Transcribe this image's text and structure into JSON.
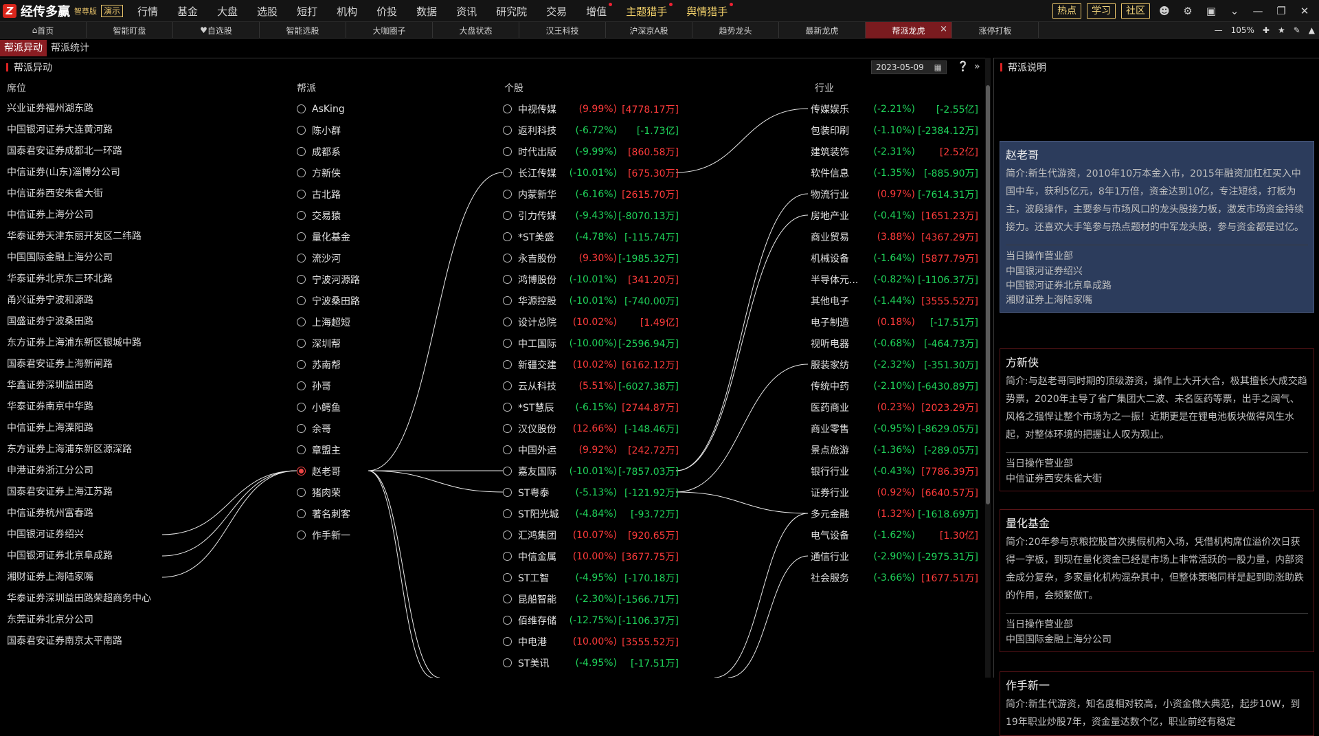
{
  "app": {
    "logo_text": "经传多赢",
    "edition": "智尊版",
    "demo": "演示",
    "menu": [
      "行情",
      "基金",
      "大盘",
      "选股",
      "短打",
      "机构",
      "价投",
      "数据",
      "资讯",
      "研究院",
      "交易",
      "增值",
      "主题猎手",
      "舆情猎手"
    ],
    "right_buttons": [
      "热点",
      "学习",
      "社区"
    ]
  },
  "tabs": [
    "首页",
    "智能盯盘",
    "自选股",
    "智能选股",
    "大咖圈子",
    "大盘状态",
    "汉王科技",
    "沪深京A股",
    "趋势龙头",
    "最新龙虎",
    "帮派龙虎",
    "涨停打板"
  ],
  "zoom": {
    "level": "105%"
  },
  "subtabs": [
    "帮派异动",
    "帮派统计"
  ],
  "main": {
    "title": "帮派异动",
    "date": "2023-05-09",
    "columns": {
      "seat": "席位",
      "gang": "帮派",
      "stock": "个股",
      "industry": "行业"
    }
  },
  "seats": [
    "兴业证券福州湖东路",
    "中国银河证券大连黄河路",
    "国泰君安证券成都北一环路",
    "中信证券(山东)淄博分公司",
    "中信证券西安朱雀大街",
    "中信证券上海分公司",
    "华泰证券天津东丽开发区二纬路",
    "中国国际金融上海分公司",
    "华泰证券北京东三环北路",
    "甬兴证券宁波和源路",
    "国盛证券宁波桑田路",
    "东方证券上海浦东新区银城中路",
    "国泰君安证券上海新闸路",
    "华鑫证券深圳益田路",
    "华泰证券南京中华路",
    "中信证券上海溧阳路",
    "东方证券上海浦东新区源深路",
    "申港证券浙江分公司",
    "国泰君安证券上海江苏路",
    "中信证券杭州富春路",
    "中国银河证券绍兴",
    "中国银河证券北京阜成路",
    "湘财证券上海陆家嘴",
    "华泰证券深圳益田路荣超商务中心",
    "东莞证券北京分公司",
    "国泰君安证券南京太平南路"
  ],
  "gangs": [
    "AsKing",
    "陈小群",
    "成都系",
    "方新侠",
    "古北路",
    "交易猿",
    "量化基金",
    "流沙河",
    "宁波河源路",
    "宁波桑田路",
    "上海超短",
    "深圳帮",
    "苏南帮",
    "孙哥",
    "小鳄鱼",
    "余哥",
    "章盟主",
    "赵老哥",
    "猪肉荣",
    "著名刺客",
    "作手新一"
  ],
  "selected_gang": "赵老哥",
  "stocks": [
    {
      "name": "中视传媒",
      "pct": "(9.99%)",
      "amt": "[4778.17万]",
      "dir": "up"
    },
    {
      "name": "返利科技",
      "pct": "(-6.72%)",
      "amt": "[-1.73亿]",
      "dir": "down"
    },
    {
      "name": "时代出版",
      "pct": "(-9.99%)",
      "amt": "[860.58万]",
      "dir": "down",
      "amt_dir": "up"
    },
    {
      "name": "长江传媒",
      "pct": "(-10.01%)",
      "amt": "[675.30万]",
      "dir": "down",
      "amt_dir": "up"
    },
    {
      "name": "内蒙新华",
      "pct": "(-6.16%)",
      "amt": "[2615.70万]",
      "dir": "down",
      "amt_dir": "up"
    },
    {
      "name": "引力传媒",
      "pct": "(-9.43%)",
      "amt": "[-8070.13万]",
      "dir": "down"
    },
    {
      "name": "*ST美盛",
      "pct": "(-4.78%)",
      "amt": "[-115.74万]",
      "dir": "down"
    },
    {
      "name": "永吉股份",
      "pct": "(9.30%)",
      "amt": "[-1985.32万]",
      "dir": "up",
      "amt_dir": "down"
    },
    {
      "name": "鸿博股份",
      "pct": "(-10.01%)",
      "amt": "[341.20万]",
      "dir": "down",
      "amt_dir": "up"
    },
    {
      "name": "华源控股",
      "pct": "(-10.01%)",
      "amt": "[-740.00万]",
      "dir": "down"
    },
    {
      "name": "设计总院",
      "pct": "(10.02%)",
      "amt": "[1.49亿]",
      "dir": "up"
    },
    {
      "name": "中工国际",
      "pct": "(-10.00%)",
      "amt": "[-2596.94万]",
      "dir": "down"
    },
    {
      "name": "新疆交建",
      "pct": "(10.02%)",
      "amt": "[6162.12万]",
      "dir": "up"
    },
    {
      "name": "云从科技",
      "pct": "(5.51%)",
      "amt": "[-6027.38万]",
      "dir": "up",
      "amt_dir": "down"
    },
    {
      "name": "*ST慧辰",
      "pct": "(-6.15%)",
      "amt": "[2744.87万]",
      "dir": "down",
      "amt_dir": "up"
    },
    {
      "name": "汉仪股份",
      "pct": "(12.66%)",
      "amt": "[-148.46万]",
      "dir": "up",
      "amt_dir": "down"
    },
    {
      "name": "中国外运",
      "pct": "(9.92%)",
      "amt": "[242.72万]",
      "dir": "up"
    },
    {
      "name": "嘉友国际",
      "pct": "(-10.01%)",
      "amt": "[-7857.03万]",
      "dir": "down"
    },
    {
      "name": "ST粤泰",
      "pct": "(-5.13%)",
      "amt": "[-121.92万]",
      "dir": "down"
    },
    {
      "name": "ST阳光城",
      "pct": "(-4.84%)",
      "amt": "[-93.72万]",
      "dir": "down"
    },
    {
      "name": "汇鸿集团",
      "pct": "(10.07%)",
      "amt": "[920.65万]",
      "dir": "up"
    },
    {
      "name": "中信金属",
      "pct": "(10.00%)",
      "amt": "[3677.75万]",
      "dir": "up"
    },
    {
      "name": "ST工智",
      "pct": "(-4.95%)",
      "amt": "[-170.18万]",
      "dir": "down"
    },
    {
      "name": "昆船智能",
      "pct": "(-2.30%)",
      "amt": "[-1566.71万]",
      "dir": "down"
    },
    {
      "name": "佰维存储",
      "pct": "(-12.75%)",
      "amt": "[-1106.37万]",
      "dir": "down"
    },
    {
      "name": "中电港",
      "pct": "(10.00%)",
      "amt": "[3555.52万]",
      "dir": "up"
    },
    {
      "name": "ST美讯",
      "pct": "(-4.95%)",
      "amt": "[-17.51万]",
      "dir": "down"
    }
  ],
  "industries": [
    {
      "name": "传媒娱乐",
      "pct": "(-2.21%)",
      "amt": "[-2.55亿]",
      "dir": "down"
    },
    {
      "name": "包装印刷",
      "pct": "(-1.10%)",
      "amt": "[-2384.12万]",
      "dir": "down"
    },
    {
      "name": "建筑装饰",
      "pct": "(-2.31%)",
      "amt": "[2.52亿]",
      "dir": "down",
      "amt_dir": "up"
    },
    {
      "name": "软件信息",
      "pct": "(-1.35%)",
      "amt": "[-885.90万]",
      "dir": "down"
    },
    {
      "name": "物流行业",
      "pct": "(0.97%)",
      "amt": "[-7614.31万]",
      "dir": "up",
      "amt_dir": "down"
    },
    {
      "name": "房地产业",
      "pct": "(-0.41%)",
      "amt": "[1651.23万]",
      "dir": "down",
      "amt_dir": "up"
    },
    {
      "name": "商业贸易",
      "pct": "(3.88%)",
      "amt": "[4367.29万]",
      "dir": "up"
    },
    {
      "name": "机械设备",
      "pct": "(-1.64%)",
      "amt": "[5877.79万]",
      "dir": "down",
      "amt_dir": "up"
    },
    {
      "name": "半导体元...",
      "pct": "(-0.82%)",
      "amt": "[-1106.37万]",
      "dir": "down"
    },
    {
      "name": "其他电子",
      "pct": "(-1.44%)",
      "amt": "[3555.52万]",
      "dir": "down",
      "amt_dir": "up"
    },
    {
      "name": "电子制造",
      "pct": "(0.18%)",
      "amt": "[-17.51万]",
      "dir": "up",
      "amt_dir": "down"
    },
    {
      "name": "视听电器",
      "pct": "(-0.68%)",
      "amt": "[-464.73万]",
      "dir": "down"
    },
    {
      "name": "服装家纺",
      "pct": "(-2.32%)",
      "amt": "[-351.30万]",
      "dir": "down"
    },
    {
      "name": "传统中药",
      "pct": "(-2.10%)",
      "amt": "[-6430.89万]",
      "dir": "down"
    },
    {
      "name": "医药商业",
      "pct": "(0.23%)",
      "amt": "[2023.29万]",
      "dir": "up"
    },
    {
      "name": "商业零售",
      "pct": "(-0.95%)",
      "amt": "[-8629.05万]",
      "dir": "down"
    },
    {
      "name": "景点旅游",
      "pct": "(-1.36%)",
      "amt": "[-289.05万]",
      "dir": "down"
    },
    {
      "name": "银行行业",
      "pct": "(-0.43%)",
      "amt": "[7786.39万]",
      "dir": "down",
      "amt_dir": "up"
    },
    {
      "name": "证券行业",
      "pct": "(0.92%)",
      "amt": "[6640.57万]",
      "dir": "up"
    },
    {
      "name": "多元金融",
      "pct": "(1.32%)",
      "amt": "[-1618.69万]",
      "dir": "up",
      "amt_dir": "down"
    },
    {
      "name": "电气设备",
      "pct": "(-1.62%)",
      "amt": "[1.30亿]",
      "dir": "down",
      "amt_dir": "up"
    },
    {
      "name": "通信行业",
      "pct": "(-2.90%)",
      "amt": "[-2975.31万]",
      "dir": "down"
    },
    {
      "name": "社会服务",
      "pct": "(-3.66%)",
      "amt": "[1677.51万]",
      "dir": "down",
      "amt_dir": "up"
    }
  ],
  "right": {
    "title": "帮派说明",
    "cards": [
      {
        "name": "赵老哥",
        "desc": "简介:新生代游资，2010年10万本金入市，2015年融资加杠杠买入中国中车，获利5亿元，8年1万倍，资金达到10亿，专注短线，打板为主，波段操作，主要参与市场风口的龙头股接力板，激发市场资金持续接力。还喜欢大手笔参与热点题材的中军龙头股，参与资金都是过亿。",
        "sub": "当日操作营业部",
        "depts": [
          "中国银河证券绍兴",
          "中国银河证券北京阜成路",
          "湘财证券上海陆家嘴"
        ]
      },
      {
        "name": "方新侠",
        "desc": "简介:与赵老哥同时期的顶级游资，操作上大开大合，极其擅长大成交趋势票，2020年主导了省广集团大二波、未名医药等票，出手之阔气、风格之强悍让整个市场为之一振！近期更是在锂电池板块做得风生水起，对整体环境的把握让人叹为观止。",
        "sub": "当日操作营业部",
        "depts": [
          "中信证券西安朱雀大街"
        ]
      },
      {
        "name": "量化基金",
        "desc": "简介:20年参与京粮控股首次携假机构入场，凭借机构席位溢价次日获得一字板，到现在量化资金已经是市场上非常活跃的一股力量，内部资金成分复杂，多家量化机构混杂其中，但整体策略同样是起到助涨助跌的作用，会频繁做T。",
        "sub": "当日操作营业部",
        "depts": [
          "中国国际金融上海分公司"
        ]
      },
      {
        "name": "作手新一",
        "desc": "简介:新生代游资，知名度相对较高，小资金做大典范，起步10W，到19年职业炒股7年，资金量达数个亿，职业前经有稳定",
        "sub": "",
        "depts": []
      }
    ]
  }
}
